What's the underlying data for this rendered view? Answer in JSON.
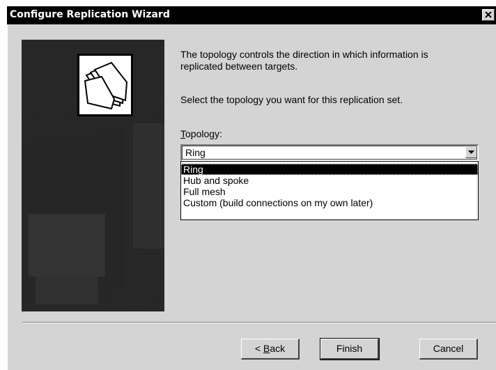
{
  "window": {
    "title": "Configure Replication Wizard"
  },
  "content": {
    "intro_line1": "The topology controls the direction in which information is",
    "intro_line2": "replicated between targets.",
    "prompt": "Select the topology you want for this replication set.",
    "topology_label_mnemonic": "T",
    "topology_label_rest": "opology:"
  },
  "combo": {
    "selected_value": "Ring",
    "options": [
      "Ring",
      "Hub and spoke",
      "Full mesh",
      "Custom (build connections on my own later)"
    ],
    "highlighted_index": 0
  },
  "buttons": {
    "back_prefix": "< ",
    "back_mnemonic": "B",
    "back_rest": "ack",
    "finish": "Finish",
    "cancel": "Cancel"
  },
  "icons": {
    "close": "close-icon",
    "dropdown_arrow": "chevron-down-icon",
    "logo": "folders-icon"
  },
  "colors": {
    "titlebar": "#000000",
    "window_face": "#d4d4d4",
    "selection": "#000000"
  }
}
